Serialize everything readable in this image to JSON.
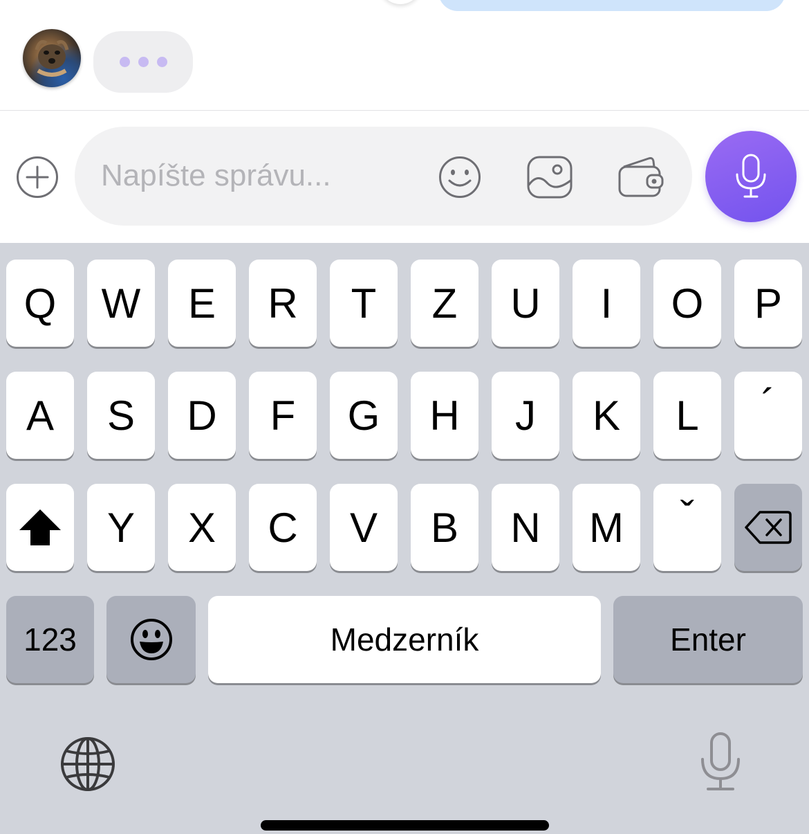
{
  "composer": {
    "placeholder": "Napíšte správu..."
  },
  "keyboard": {
    "row1": [
      "Q",
      "W",
      "E",
      "R",
      "T",
      "Z",
      "U",
      "I",
      "O",
      "P"
    ],
    "row2": [
      "A",
      "S",
      "D",
      "F",
      "G",
      "H",
      "J",
      "K",
      "L",
      "´"
    ],
    "row3": [
      "Y",
      "X",
      "C",
      "V",
      "B",
      "N",
      "M",
      "ˇ"
    ],
    "numbers_label": "123",
    "space_label": "Medzerník",
    "enter_label": "Enter"
  },
  "colors": {
    "accent": "#7353ee",
    "typing_dots": "#c7baf2",
    "keyboard_bg": "#d1d4db"
  },
  "icons": {
    "add": "plus-circle-icon",
    "emoji": "smiley-icon",
    "image": "image-icon",
    "wallet": "wallet-icon",
    "mic": "microphone-icon",
    "shift": "shift-arrow-icon",
    "backspace": "backspace-icon",
    "globe": "globe-icon",
    "dictation": "dictation-mic-icon"
  }
}
